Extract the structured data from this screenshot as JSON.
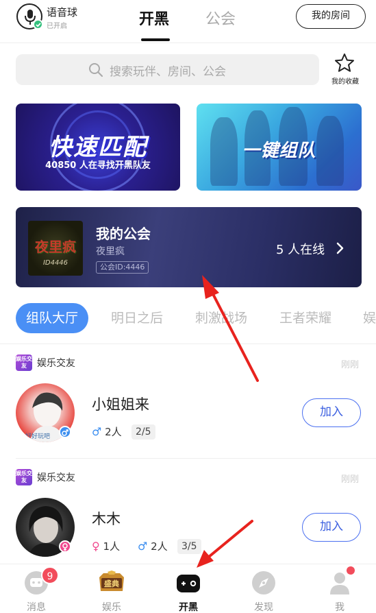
{
  "header": {
    "voice_ball_title": "语音球",
    "voice_ball_status": "已开启",
    "tab_kaihei": "开黑",
    "tab_gonghui": "公会",
    "my_room_button": "我的房间"
  },
  "search": {
    "placeholder": "搜索玩伴、房间、公会",
    "favorites_label": "我的收藏"
  },
  "banners": {
    "quick_match_title": "快速匹配",
    "quick_match_subtitle": "40850 人在寻找开黑队友",
    "team_up_title": "一键组队"
  },
  "guild": {
    "title": "我的公会",
    "name": "夜里疯",
    "id_label": "公会ID:4446",
    "online_label": "5 人在线",
    "logo_text": "夜里疯",
    "logo_id": "ID4446"
  },
  "category_tabs": [
    {
      "label": "组队大厅",
      "active": true
    },
    {
      "label": "明日之后",
      "active": false
    },
    {
      "label": "刺激战场",
      "active": false
    },
    {
      "label": "王者荣耀",
      "active": false
    },
    {
      "label": "娱",
      "active": false
    }
  ],
  "rooms": [
    {
      "tag": "娱乐交友",
      "tag_icon_text": "娱乐交友",
      "time": "刚刚",
      "name": "小姐姐来",
      "avatar_caption": "好好玩吧",
      "owner_gender": "male",
      "male_symbol": "♂",
      "male_count": "2人",
      "female_symbol": "",
      "female_count": "",
      "capacity": "2/5",
      "join_label": "加入"
    },
    {
      "tag": "娱乐交友",
      "tag_icon_text": "娱乐交友",
      "time": "刚刚",
      "name": "木木",
      "owner_gender": "female",
      "female_symbol": "♀",
      "female_count": "1人",
      "male_symbol": "♂",
      "male_count": "2人",
      "capacity": "3/5",
      "join_label": "加入"
    }
  ],
  "bottom_nav": [
    {
      "label": "消息",
      "icon": "message-icon",
      "badge": "9",
      "active": false
    },
    {
      "label": "娱乐",
      "icon": "shengdian-icon",
      "icon_text": "盛典",
      "active": false
    },
    {
      "label": "开黑",
      "icon": "gamepad-icon",
      "active": true
    },
    {
      "label": "发现",
      "icon": "compass-icon",
      "active": false
    },
    {
      "label": "我",
      "icon": "person-icon",
      "dot": true,
      "active": false
    }
  ],
  "colors": {
    "accent_blue": "#4a8ff5",
    "join_border": "#4a6ff0",
    "badge_red": "#f24c5b",
    "arrow_red": "#e8231e",
    "male_blue": "#3b8ef0",
    "female_pink": "#f04a8f"
  }
}
